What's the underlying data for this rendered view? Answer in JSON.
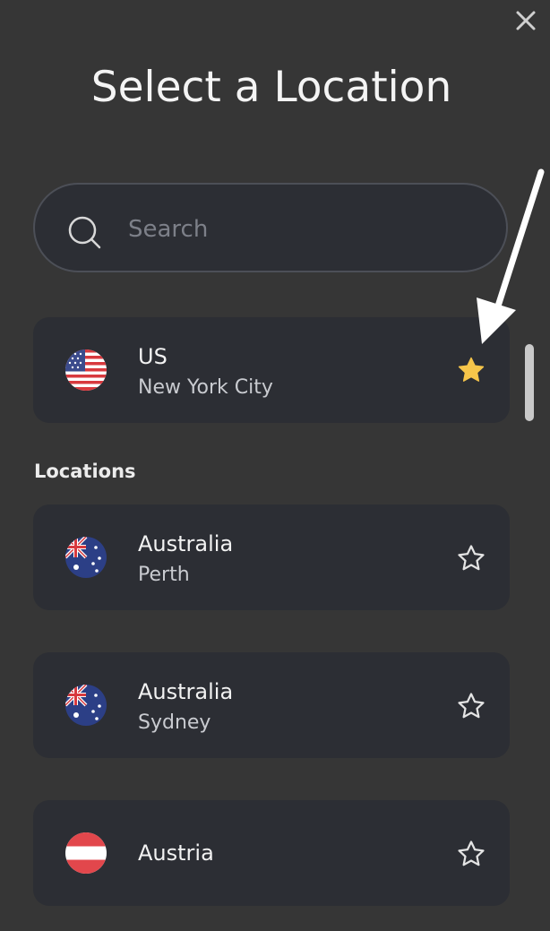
{
  "header": {
    "title": "Select a Location",
    "close_icon": "close-icon"
  },
  "search": {
    "placeholder": "Search",
    "value": "",
    "icon": "search-icon"
  },
  "favorite": {
    "country": "US",
    "city": "New York City",
    "flag": "us-flag",
    "starred": true,
    "star_color": "#f6c54a"
  },
  "locations_section": {
    "label": "Locations"
  },
  "locations": [
    {
      "country": "Australia",
      "city": "Perth",
      "flag": "australia-flag",
      "starred": false
    },
    {
      "country": "Australia",
      "city": "Sydney",
      "flag": "australia-flag",
      "starred": false
    },
    {
      "country": "Austria",
      "city": "",
      "flag": "austria-flag",
      "starred": false
    }
  ],
  "colors": {
    "background": "#363636",
    "card": "#2c2e34",
    "text": "#f2f2f2",
    "subtext": "#c9cbd0"
  }
}
